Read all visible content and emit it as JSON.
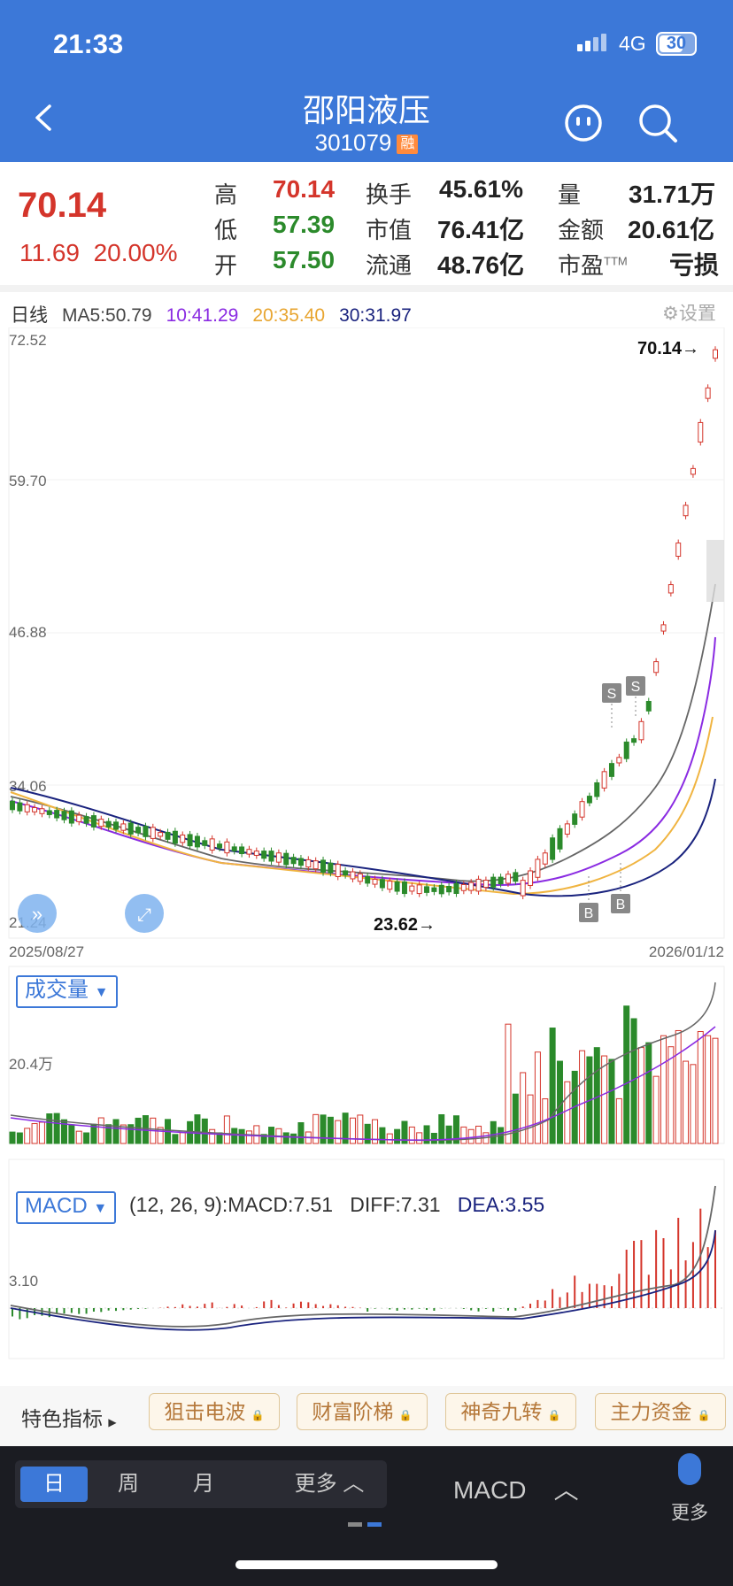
{
  "status_bar": {
    "time": "21:33",
    "network": "4G",
    "battery": "30"
  },
  "header": {
    "title": "邵阳液压",
    "code": "301079",
    "badge": "融"
  },
  "quote": {
    "price": "70.14",
    "change": "11.69",
    "change_pct": "20.00%",
    "high_label": "高",
    "high": "70.14",
    "low_label": "低",
    "low": "57.39",
    "open_label": "开",
    "open": "57.50",
    "turnover_label": "换手",
    "turnover": "45.61%",
    "mcap_label": "市值",
    "mcap": "76.41亿",
    "float_label": "流通",
    "float": "48.76亿",
    "vol_label": "量",
    "vol": "31.71万",
    "amount_label": "金额",
    "amount": "20.61亿",
    "pe_label": "市盈",
    "pe_sup": "TTM",
    "pe": "亏损"
  },
  "kline": {
    "period": "日线",
    "ma5": "MA5:50.79",
    "ma10": "10:41.29",
    "ma20": "20:35.40",
    "ma30": "30:31.97",
    "settings": "设置",
    "y_ticks": [
      "72.52",
      "59.70",
      "46.88",
      "34.06",
      "21.24"
    ],
    "max_label": "70.14→",
    "min_label": "23.62→",
    "date_start": "2025/08/27",
    "date_end": "2026/01/12",
    "signal_s": "S",
    "signal_b": "B",
    "colors": {
      "up": "#d4352b",
      "down": "#2b8a2b",
      "ma5": "#666666",
      "ma10": "#8a2be2",
      "ma20": "#f0b440",
      "ma30": "#1a237e"
    }
  },
  "volume": {
    "selector": "成交量",
    "y_tick": "20.4万"
  },
  "macd": {
    "selector": "MACD",
    "params": "(12, 26, 9):MACD:7.51",
    "diff": "DIFF:7.31",
    "dea": "DEA:3.55",
    "y_tick": "3.10"
  },
  "tools": {
    "feature": "特色指标",
    "items": [
      "狙击电波",
      "财富阶梯",
      "神奇九转",
      "主力资金"
    ]
  },
  "bottom_nav": {
    "day": "日",
    "week": "周",
    "month": "月",
    "more": "更多",
    "indicator": "MACD",
    "more_right": "更多"
  }
}
